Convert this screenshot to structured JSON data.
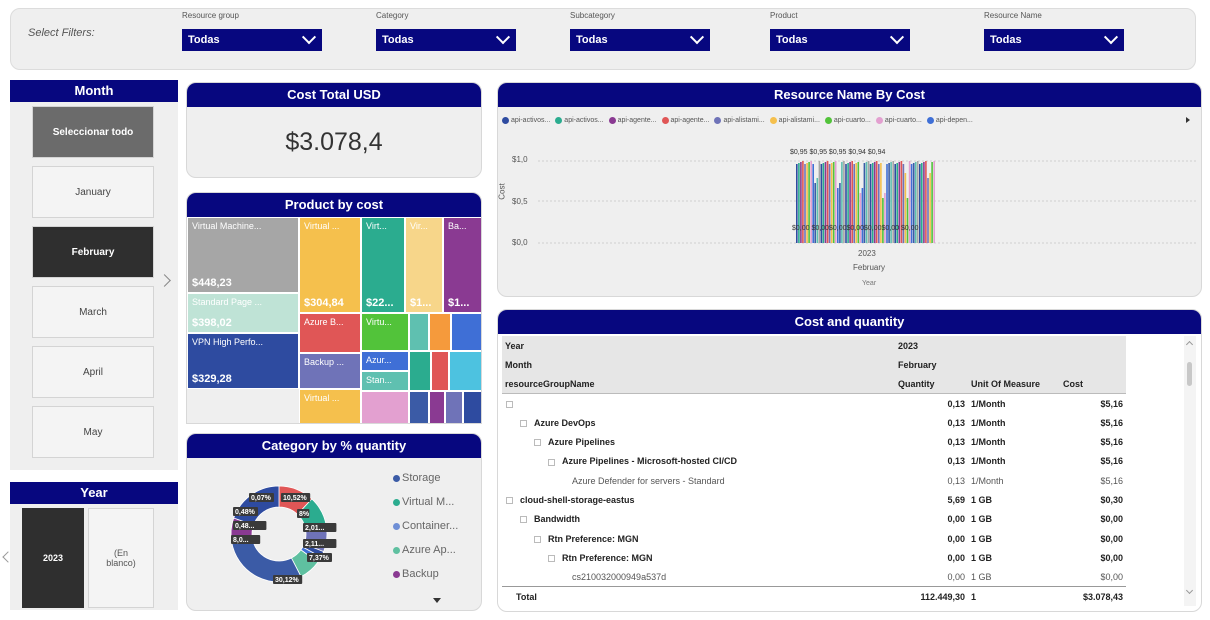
{
  "filters": {
    "title": "Select Filters:",
    "items": [
      {
        "label": "Resource group",
        "value": "Todas"
      },
      {
        "label": "Category",
        "value": "Todas"
      },
      {
        "label": "Subcategory",
        "value": "Todas"
      },
      {
        "label": "Product",
        "value": "Todas"
      },
      {
        "label": "Resource Name",
        "value": "Todas"
      }
    ]
  },
  "month_slicer": {
    "title": "Month",
    "items": [
      "Seleccionar todo",
      "January",
      "February",
      "March",
      "April",
      "May"
    ],
    "selected": "February"
  },
  "year_slicer": {
    "title": "Year",
    "items": [
      "2023",
      "(En blanco)"
    ],
    "selected": "2023"
  },
  "cost_card": {
    "title": "Cost Total USD",
    "value": "$3.078,4"
  },
  "product_treemap": {
    "title": "Product by cost",
    "tiles": [
      {
        "label": "Virtual Machine...",
        "value": "$448,23",
        "color": "#a6a6a6"
      },
      {
        "label": "Standard Page ...",
        "value": "$398,02",
        "color": "#bfe3d6"
      },
      {
        "label": "VPN High Perfo...",
        "value": "$329,28",
        "color": "#2e4ba0"
      },
      {
        "label": "Virtual ...",
        "value": "$304,84",
        "color": "#f5c04d"
      },
      {
        "label": "Virt...",
        "value": "$22...",
        "color": "#2bac8f"
      },
      {
        "label": "Vir...",
        "value": "$1...",
        "color": "#f7d68a"
      },
      {
        "label": "Ba...",
        "value": "$1...",
        "color": "#8a3a92"
      },
      {
        "label": "Azure B...",
        "value": "",
        "color": "#e05656"
      },
      {
        "label": "Backup ...",
        "value": "",
        "color": "#6f73b8"
      },
      {
        "label": "Virtual ...",
        "value": "",
        "color": "#f5c04d"
      },
      {
        "label": "Virtu...",
        "value": "",
        "color": "#52c33a"
      },
      {
        "label": "Azur...",
        "value": "",
        "color": "#3f6fd6"
      },
      {
        "label": "Stan...",
        "value": "",
        "color": "#5fc0b0"
      }
    ]
  },
  "category_donut": {
    "title": "Category by % quantity",
    "labels": [
      "0,07%",
      "10,52%",
      "0,48%",
      "0,48...",
      "8,0...",
      "8%",
      "2,01...",
      "2,11...",
      "7,37%",
      "30,12%"
    ],
    "legend": [
      {
        "name": "Storage",
        "color": "#3b5ba6"
      },
      {
        "name": "Virtual M...",
        "color": "#2bac8f"
      },
      {
        "name": "Container...",
        "color": "#6f8fd6"
      },
      {
        "name": "Azure Ap...",
        "color": "#5fc0a0"
      },
      {
        "name": "Backup",
        "color": "#8a3a92"
      }
    ]
  },
  "resource_chart": {
    "title": "Resource Name By Cost",
    "legend": [
      {
        "name": "api-activos...",
        "color": "#2e4ba0"
      },
      {
        "name": "api-activos...",
        "color": "#2bac8f"
      },
      {
        "name": "api-agente...",
        "color": "#8a3a92"
      },
      {
        "name": "api-agente...",
        "color": "#e05656"
      },
      {
        "name": "api-alistami...",
        "color": "#6f73b8"
      },
      {
        "name": "api-alistami...",
        "color": "#f5c04d"
      },
      {
        "name": "api-cuarto...",
        "color": "#52c33a"
      },
      {
        "name": "api-cuarto...",
        "color": "#e3a0d0"
      },
      {
        "name": "api-depen...",
        "color": "#3f6fd6"
      }
    ],
    "top_labels": "$0,95 $0,95  $0,95 $0,94 $0,94",
    "bottom_labels": "$0,00 $0,00$0,00$0,00$0,00$0,00 $0,00",
    "yaxis_title": "Cost",
    "yticks": [
      "$1,0",
      "$0,5",
      "$0,0"
    ],
    "x_year": "2023",
    "x_month": "February",
    "xaxis_title": "Year"
  },
  "cost_table": {
    "title": "Cost and quantity",
    "header_rows": [
      {
        "label": "Year",
        "col": "2023"
      },
      {
        "label": "Month",
        "col": "February"
      }
    ],
    "col_headers": {
      "name": "resourceGroupName",
      "quantity": "Quantity",
      "unit": "Unit Of Measure",
      "cost": "Cost"
    },
    "rows": [
      {
        "indent": 0,
        "icon": true,
        "name": "",
        "quantity": "0,13",
        "unit": "1/Month",
        "cost": "$5,16",
        "bold": true
      },
      {
        "indent": 1,
        "icon": true,
        "name": "Azure DevOps",
        "quantity": "0,13",
        "unit": "1/Month",
        "cost": "$5,16",
        "bold": true
      },
      {
        "indent": 2,
        "icon": true,
        "name": "Azure Pipelines",
        "quantity": "0,13",
        "unit": "1/Month",
        "cost": "$5,16",
        "bold": true
      },
      {
        "indent": 3,
        "icon": true,
        "name": "Azure Pipelines - Microsoft-hosted CI/CD",
        "quantity": "0,13",
        "unit": "1/Month",
        "cost": "$5,16",
        "bold": true
      },
      {
        "indent": 4,
        "icon": false,
        "name": "Azure Defender for servers - Standard",
        "quantity": "0,13",
        "unit": "1/Month",
        "cost": "$5,16",
        "bold": false
      },
      {
        "indent": 0,
        "icon": true,
        "name": "cloud-shell-storage-eastus",
        "quantity": "5,69",
        "unit": "1 GB",
        "cost": "$0,30",
        "bold": true
      },
      {
        "indent": 1,
        "icon": true,
        "name": "Bandwidth",
        "quantity": "0,00",
        "unit": "1 GB",
        "cost": "$0,00",
        "bold": true
      },
      {
        "indent": 2,
        "icon": true,
        "name": "Rtn Preference: MGN",
        "quantity": "0,00",
        "unit": "1 GB",
        "cost": "$0,00",
        "bold": true
      },
      {
        "indent": 3,
        "icon": true,
        "name": "Rtn Preference: MGN",
        "quantity": "0,00",
        "unit": "1 GB",
        "cost": "$0,00",
        "bold": true
      },
      {
        "indent": 4,
        "icon": false,
        "name": "cs210032000949a537d",
        "quantity": "0,00",
        "unit": "1 GB",
        "cost": "$0,00",
        "bold": false
      }
    ],
    "total": {
      "name": "Total",
      "quantity": "112.449,30",
      "unit": "1",
      "cost": "$3.078,43"
    }
  }
}
